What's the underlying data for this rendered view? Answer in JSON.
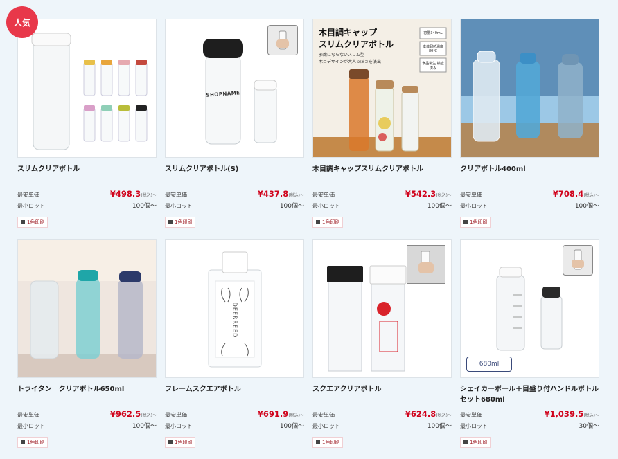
{
  "products": [
    {
      "title": "スリムクリアボトル",
      "price_label": "最安単価",
      "price": "¥498.3",
      "tax": "(税込)～",
      "lot_label": "最小ロット",
      "lot": "100個～",
      "print": "1色印刷",
      "badge": "人気"
    },
    {
      "title": "スリムクリアボトル(S)",
      "price_label": "最安単価",
      "price": "¥437.8",
      "tax": "(税込)～",
      "lot_label": "最小ロット",
      "lot": "100個～",
      "print": "1色印刷",
      "logo": "SHOPNAME"
    },
    {
      "title": "木目調キャップスリムクリアボトル",
      "price_label": "最安単価",
      "price": "¥542.3",
      "tax": "(税込)～",
      "lot_label": "最小ロット",
      "lot": "100個～",
      "print": "1色印刷",
      "promo": {
        "headline1": "木目調キャップ",
        "headline2": "スリムクリアボトル",
        "sub1": "邪魔にならないスリム型",
        "sub2": "木目デザインが大人っぽさを演出",
        "spec1": "容量340mL",
        "spec2": "本体耐熱温度 80℃",
        "spec3": "食品衛生 検査済み"
      }
    },
    {
      "title": "クリアボトル400ml",
      "price_label": "最安単価",
      "price": "¥708.4",
      "tax": "(税込)～",
      "lot_label": "最小ロット",
      "lot": "100個～",
      "print": "1色印刷"
    },
    {
      "title": "トライタン　クリアボトル650ml",
      "price_label": "最安単価",
      "price": "¥962.5",
      "tax": "(税込)～",
      "lot_label": "最小ロット",
      "lot": "100個～",
      "print": "1色印刷"
    },
    {
      "title": "フレームスクエアボトル",
      "price_label": "最安単価",
      "price": "¥691.9",
      "tax": "(税込)～",
      "lot_label": "最小ロット",
      "lot": "100個～",
      "print": "1色印刷",
      "logo": "DEERREED"
    },
    {
      "title": "スクエアクリアボトル",
      "price_label": "最安単価",
      "price": "¥624.8",
      "tax": "(税込)～",
      "lot_label": "最小ロット",
      "lot": "100個～",
      "print": "1色印刷"
    },
    {
      "title": "シェイカーボール＋目盛り付ハンドルボトルセット680ml",
      "price_label": "最安単価",
      "price": "¥1,039.5",
      "tax": "(税込)～",
      "lot_label": "最小ロット",
      "lot": "30個～",
      "print": "1色印刷",
      "size_tag": "680ml"
    }
  ],
  "colors": {
    "price": "#d0021b",
    "badge": "#e8384a",
    "background": "#eef5fa"
  }
}
